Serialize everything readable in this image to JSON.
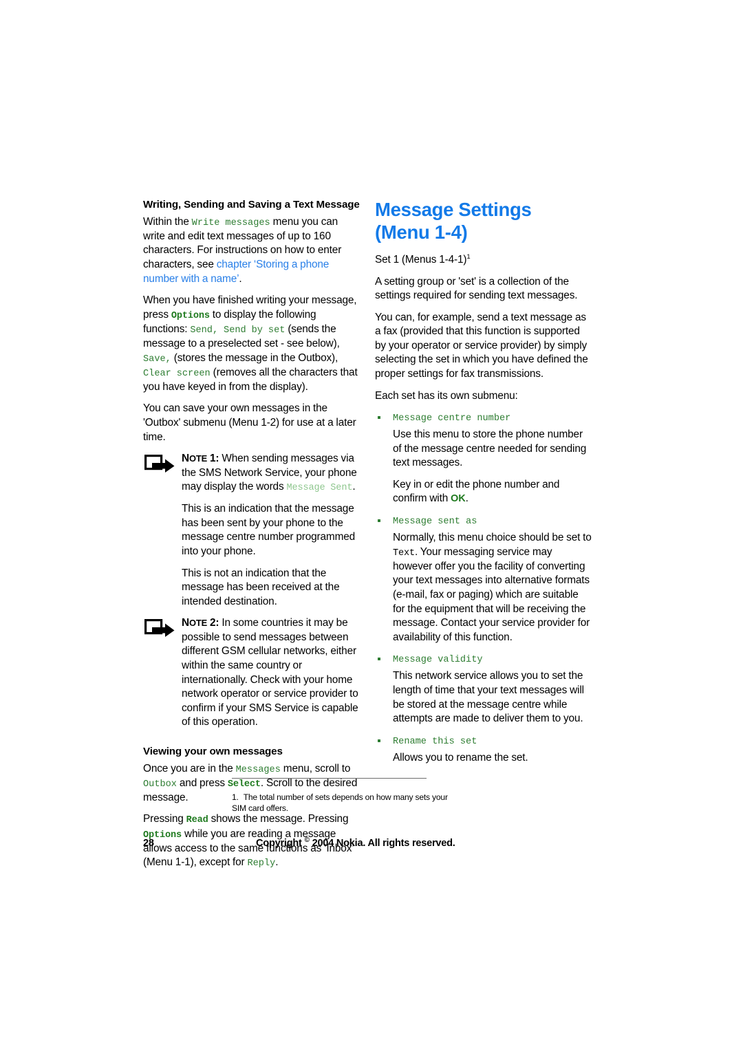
{
  "page": {
    "number": "28",
    "copyright_prefix": "Copyright",
    "copyright_mark": "©",
    "copyright_rest": "2004 Nokia. All rights reserved."
  },
  "left_column": {
    "section_heading": "Writing, Sending and Saving a Text Message",
    "p1": {
      "a": "Within the ",
      "mono1": "Write messages",
      "b": " menu you can write and edit text messages of up to 160 characters. For instructions on how to enter characters, see ",
      "link": "chapter ‘Storing a phone number with a name’",
      "c": "."
    },
    "p2": {
      "a": "When you have finished writing your message, press ",
      "mono_b1": "Options",
      "b": " to display the following functions: ",
      "mono1": "Send, Send by set",
      "c": " (sends the message to a preselected set - see below), ",
      "mono2": "Save,",
      "d": " (stores the message in the Outbox), ",
      "mono3": "Clear screen",
      "e": " (removes all the characters that you have keyed in from the display)."
    },
    "p3": "You can save your own messages in the 'Outbox' submenu (Menu 1-2) for use at a later time.",
    "note1": {
      "label_note": "N",
      "label_ote": "OTE",
      "label_num": " 1:",
      "a": " When sending messages via the SMS Network Service, your phone may display the words ",
      "mono1": "Message Sent",
      "b": ".",
      "sub1": "This is an indication that the message has been sent by your phone to the message centre number programmed into your phone.",
      "sub2": "This is not an indication that the message has been received at the intended destination."
    },
    "note2": {
      "label_note": "N",
      "label_ote": "OTE",
      "label_num": " 2:",
      "a": " In some countries it may be possible to send messages between different GSM cellular networks, either within the same country or internationally. Check with your home network operator or service provider to confirm if your SMS Service is capable of this operation."
    },
    "section_heading2": "Viewing your own messages",
    "p4": {
      "a": "Once you are in the ",
      "mono1": "Messages",
      "b": " menu, scroll to ",
      "mono2": "Outbox",
      "c": " and press ",
      "mono_b1": "Select",
      "d": ". Scroll to the desired message."
    },
    "p5": {
      "a": "Pressing ",
      "mono_b1": "Read",
      "b": " shows the message. Pressing ",
      "mono_b2": "Options",
      "c": " while you are reading a message allows access to the same functions as ‘Inbox’ (Menu 1-1), except for ",
      "mono1": "Reply",
      "d": "."
    }
  },
  "right_column": {
    "chapter_title_line1": "Message Settings",
    "chapter_title_line2": "(Menu 1-4)",
    "subhead": "Set 1 (Menus 1-4-1)",
    "subhead_sup": "1",
    "p1": "A setting group or 'set' is a collection of the settings required for sending text messages.",
    "p2": "You can, for example, send a text message as a fax (provided that this function is supported by your operator or service provider) by simply selecting the set in which you have defined the proper settings for fax transmissions.",
    "p3": "Each set has its own submenu:",
    "bullets": [
      {
        "label": "Message centre number",
        "paras": [
          {
            "plain": "Use this menu to store the phone number of the message centre needed for sending text messages."
          },
          {
            "a": "Key in or edit the phone number and confirm with ",
            "bold_green": "OK",
            "b": "."
          }
        ]
      },
      {
        "label": "Message sent as",
        "paras": [
          {
            "a": "Normally, this menu choice should be set to ",
            "mono_black": "Text",
            "b": ". Your messaging service may however offer you the facility of converting your text messages into alternative formats (e-mail, fax or paging) which are suitable for the equipment that will be receiving the message. Contact your service provider for availability of this function."
          }
        ]
      },
      {
        "label": "Message validity",
        "paras": [
          {
            "plain": "This network service allows you to set the length of time that your text messages will be stored at the message centre while attempts are made to deliver them to you."
          }
        ]
      },
      {
        "label": "Rename this set",
        "paras": [
          {
            "plain": "Allows you to rename the set."
          }
        ]
      }
    ],
    "footnote_number": "1.",
    "footnote_text": "The total number of sets depends on how many sets your SIM card offers."
  },
  "colors": {
    "heading_blue": "#137ae8",
    "link_blue": "#2a80e8",
    "menu_green": "#2e7d32",
    "menu_green_bold": "#1f7a1f",
    "menu_green_dim": "#8fc78f",
    "text_black": "#000000",
    "rule_gray": "#6d6d6d"
  }
}
